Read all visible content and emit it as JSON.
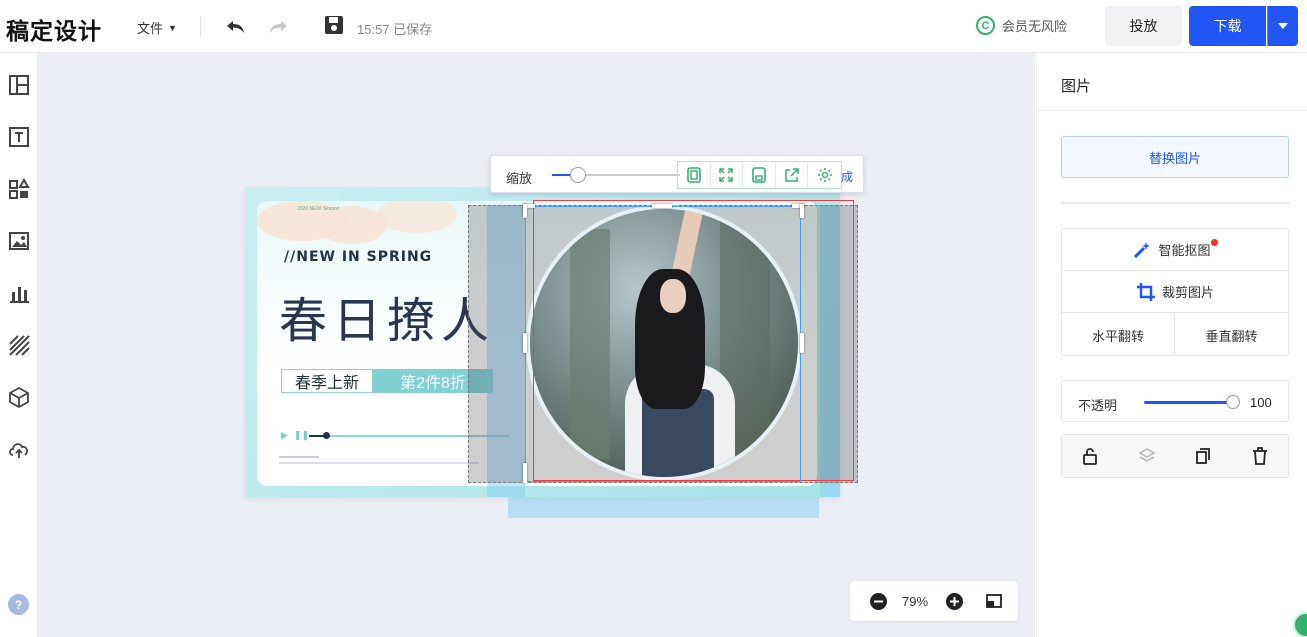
{
  "header": {
    "logo": "稿定设计",
    "file_menu": "文件",
    "save_status": "15:57 已保存",
    "vip_label": "会员无风险",
    "present_label": "投放",
    "download_label": "下载"
  },
  "sidebar": {
    "items": [
      "template-icon",
      "text-icon",
      "elements-icon",
      "image-icon",
      "chart-icon",
      "pattern-icon",
      "3d-cube-icon",
      "upload-icon"
    ],
    "help_label": "?"
  },
  "poster": {
    "small_text": "2020 NEW Season",
    "subtitle": "//NEW IN SPRING",
    "title": "春日撩人",
    "tag1": "春季上新",
    "tag2": "第2件8折"
  },
  "crop_toolbar": {
    "zoom_label": "缩放",
    "zoom_level": 0.2,
    "done_label": "成"
  },
  "zoom": {
    "value": "79%"
  },
  "panel": {
    "title": "图片",
    "replace_label": "替换图片",
    "smart_cutout_label": "智能抠图",
    "crop_label": "裁剪图片",
    "flip_h_label": "水平翻转",
    "flip_v_label": "垂直翻转",
    "opacity_label": "不透明",
    "opacity_value": "100"
  },
  "colors": {
    "accent": "#2156f5",
    "vip_green": "#2fb36a",
    "canvas_bg": "#eceef5",
    "poster_teal": "#a9e3e6"
  }
}
